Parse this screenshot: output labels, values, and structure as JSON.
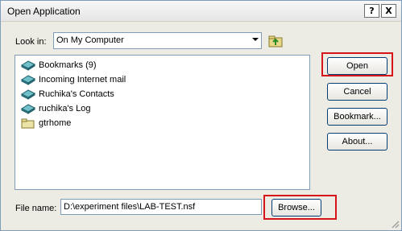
{
  "window": {
    "title": "Open Application",
    "help_glyph": "?",
    "close_glyph": "X"
  },
  "look_in": {
    "label": "Look in:",
    "value": "On My Computer"
  },
  "list": {
    "items": [
      {
        "label": "Bookmarks (9)",
        "icon": "database-icon"
      },
      {
        "label": "Incoming Internet mail",
        "icon": "database-icon"
      },
      {
        "label": "Ruchika's Contacts",
        "icon": "database-icon"
      },
      {
        "label": "ruchika's Log",
        "icon": "database-icon"
      },
      {
        "label": "gtrhome",
        "icon": "folder-icon"
      }
    ]
  },
  "buttons": {
    "open": "Open",
    "cancel": "Cancel",
    "bookmark": "Bookmark...",
    "about": "About...",
    "browse": "Browse..."
  },
  "file_name": {
    "label": "File name:",
    "value": "D:\\experiment files\\LAB-TEST.nsf"
  },
  "colors": {
    "highlight": "#d8141b",
    "dialog_bg": "#ecebe4",
    "field_border": "#7f9db9"
  }
}
